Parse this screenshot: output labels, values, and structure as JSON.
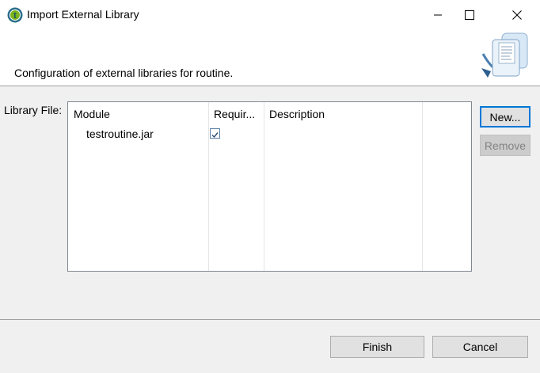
{
  "window": {
    "title": "Import External Library",
    "app_icon": "talend-t-icon"
  },
  "banner": {
    "description": "Configuration of external libraries for routine.",
    "image": "library-document-icon"
  },
  "form": {
    "library_label": "Library File:"
  },
  "table": {
    "columns": [
      "Module",
      "Requir...",
      "Description"
    ],
    "rows": [
      {
        "module": "testroutine.jar",
        "required": true,
        "description": ""
      }
    ]
  },
  "side_buttons": {
    "new_label": "New...",
    "remove_label": "Remove"
  },
  "footer": {
    "finish_label": "Finish",
    "cancel_label": "Cancel"
  }
}
